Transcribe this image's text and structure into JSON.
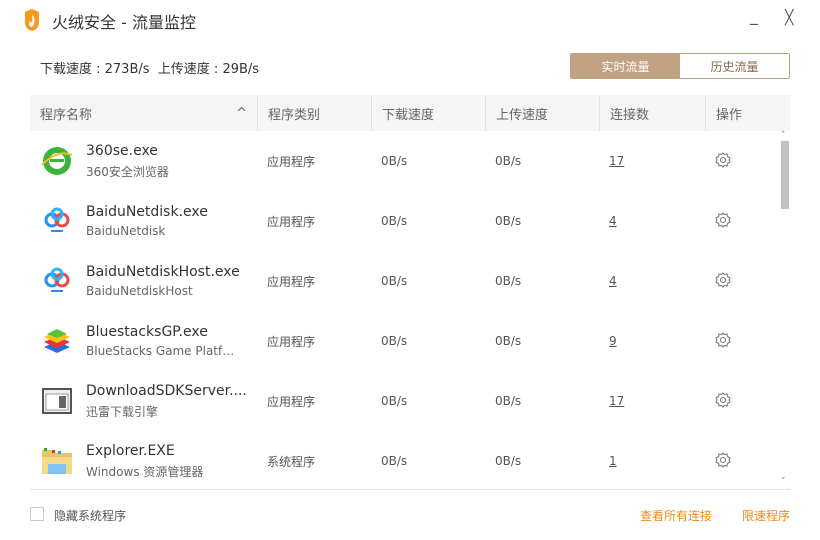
{
  "window": {
    "title": "火绒安全 - 流量监控",
    "minimize": "_",
    "close": "╳"
  },
  "summary": {
    "text": "下载速度 : 273B/s  上传速度 : 29B/s"
  },
  "tabs": [
    {
      "label": "实时流量",
      "active": true
    },
    {
      "label": "历史流量",
      "active": false
    }
  ],
  "columns": [
    "程序名称",
    "程序类别",
    "下载速度",
    "上传速度",
    "连接数",
    "操作"
  ],
  "sort_icon": "^",
  "rows": [
    {
      "name": "360se.exe",
      "desc": "360安全浏览器",
      "type": "应用程序",
      "down": "0B/s",
      "up": "0B/s",
      "conn": "17",
      "icon": "360se"
    },
    {
      "name": "BaiduNetdisk.exe",
      "desc": "BaiduNetdisk",
      "type": "应用程序",
      "down": "0B/s",
      "up": "0B/s",
      "conn": "4",
      "icon": "baidu"
    },
    {
      "name": "BaiduNetdiskHost.exe",
      "desc": "BaiduNetdiskHost",
      "type": "应用程序",
      "down": "0B/s",
      "up": "0B/s",
      "conn": "4",
      "icon": "baidu"
    },
    {
      "name": "BluestacksGP.exe",
      "desc": "BlueStacks Game Platfor...",
      "type": "应用程序",
      "down": "0B/s",
      "up": "0B/s",
      "conn": "9",
      "icon": "bluestacks"
    },
    {
      "name": "DownloadSDKServer....",
      "desc": "迅雷下载引擎",
      "type": "应用程序",
      "down": "0B/s",
      "up": "0B/s",
      "conn": "17",
      "icon": "app"
    },
    {
      "name": "Explorer.EXE",
      "desc": "Windows 资源管理器",
      "type": "系统程序",
      "down": "0B/s",
      "up": "0B/s",
      "conn": "1",
      "icon": "folder"
    }
  ],
  "footer": {
    "hide_system": "隐藏系统程序",
    "view_all": "查看所有连接",
    "limit": "限速程序"
  },
  "colors": {
    "accent": "#c1a384",
    "link": "#f08a1c"
  }
}
